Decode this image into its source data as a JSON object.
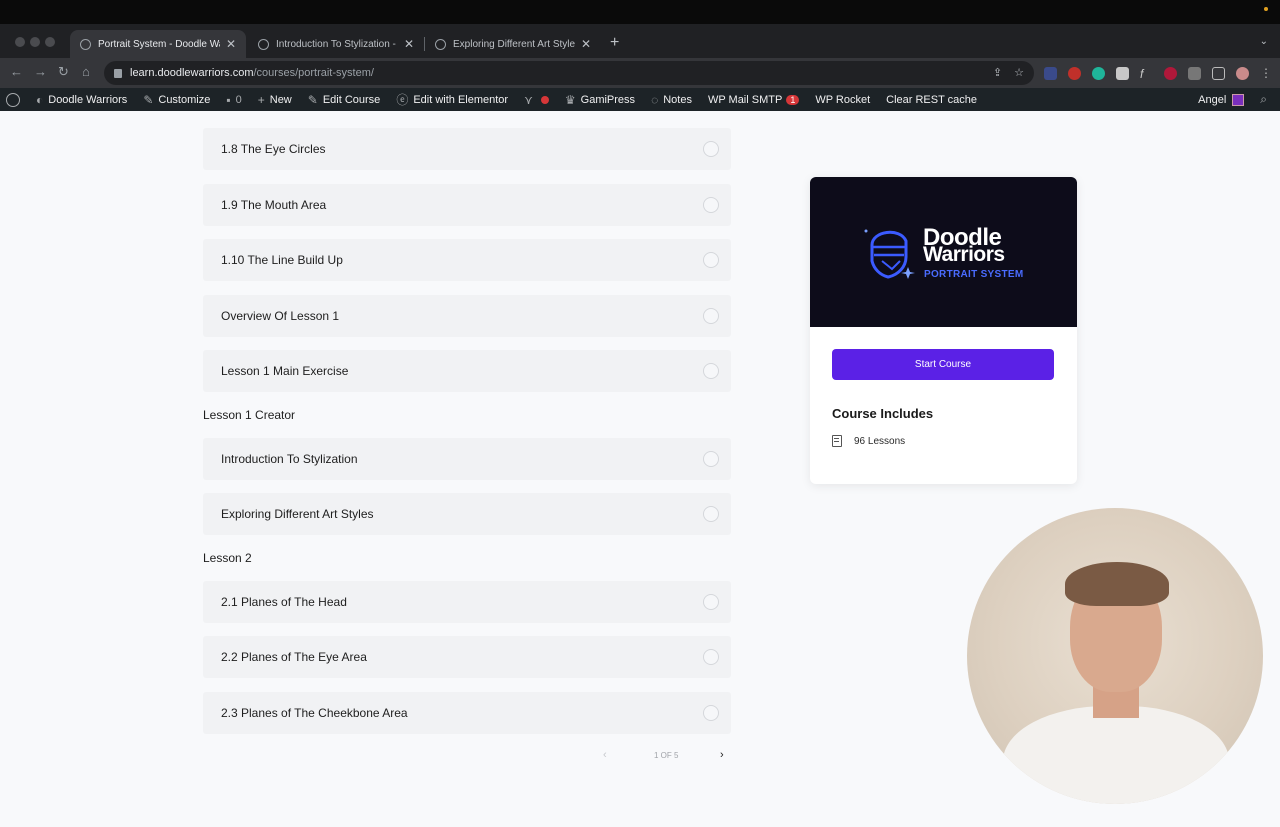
{
  "browser": {
    "tabs": [
      {
        "title": "Portrait System - Doodle Warriors",
        "active": true
      },
      {
        "title": "Introduction To Stylization - Doodle Warriors",
        "active": false
      },
      {
        "title": "Exploring Different Art Styles - Doodle Warriors",
        "active": false
      }
    ],
    "url_host": "learn.doodlewarriors.com",
    "url_path": "/courses/portrait-system/"
  },
  "wpbar": {
    "site_name": "Doodle Warriors",
    "customize": "Customize",
    "comments_count": "0",
    "new_label": "New",
    "edit_course": "Edit Course",
    "edit_elementor": "Edit with Elementor",
    "gamipress": "GamiPress",
    "notes": "Notes",
    "wp_mail_smtp": "WP Mail SMTP",
    "wp_mail_badge": "1",
    "wp_rocket": "WP Rocket",
    "clear_rest": "Clear REST cache",
    "user_name": "Angel"
  },
  "lessons": {
    "l1_8": "1.8 The Eye Circles",
    "l1_9": "1.9 The Mouth Area",
    "l1_10": "1.10 The Line Build Up",
    "overview1": "Overview Of Lesson 1",
    "main_ex1": "Lesson 1 Main Exercise",
    "section_creator": "Lesson 1 Creator",
    "intro_stylization": "Introduction To Stylization",
    "exploring_styles": "Exploring Different Art Styles",
    "section_lesson2": "Lesson 2",
    "l2_1": "2.1 Planes of The Head",
    "l2_2": "2.2 Planes of The Eye Area",
    "l2_3": "2.3 Planes of The Cheekbone Area"
  },
  "pager": {
    "label": "1 OF 5"
  },
  "card": {
    "brand_line1": "Doodle",
    "brand_line2": "Warriors",
    "brand_line3": "PORTRAIT SYSTEM",
    "start_button": "Start Course",
    "includes_title": "Course Includes",
    "lessons_count": "96 Lessons"
  },
  "colors": {
    "accent": "#5b21e6",
    "brand_blue": "#4a6cff",
    "wp_bar": "#1d2327"
  }
}
